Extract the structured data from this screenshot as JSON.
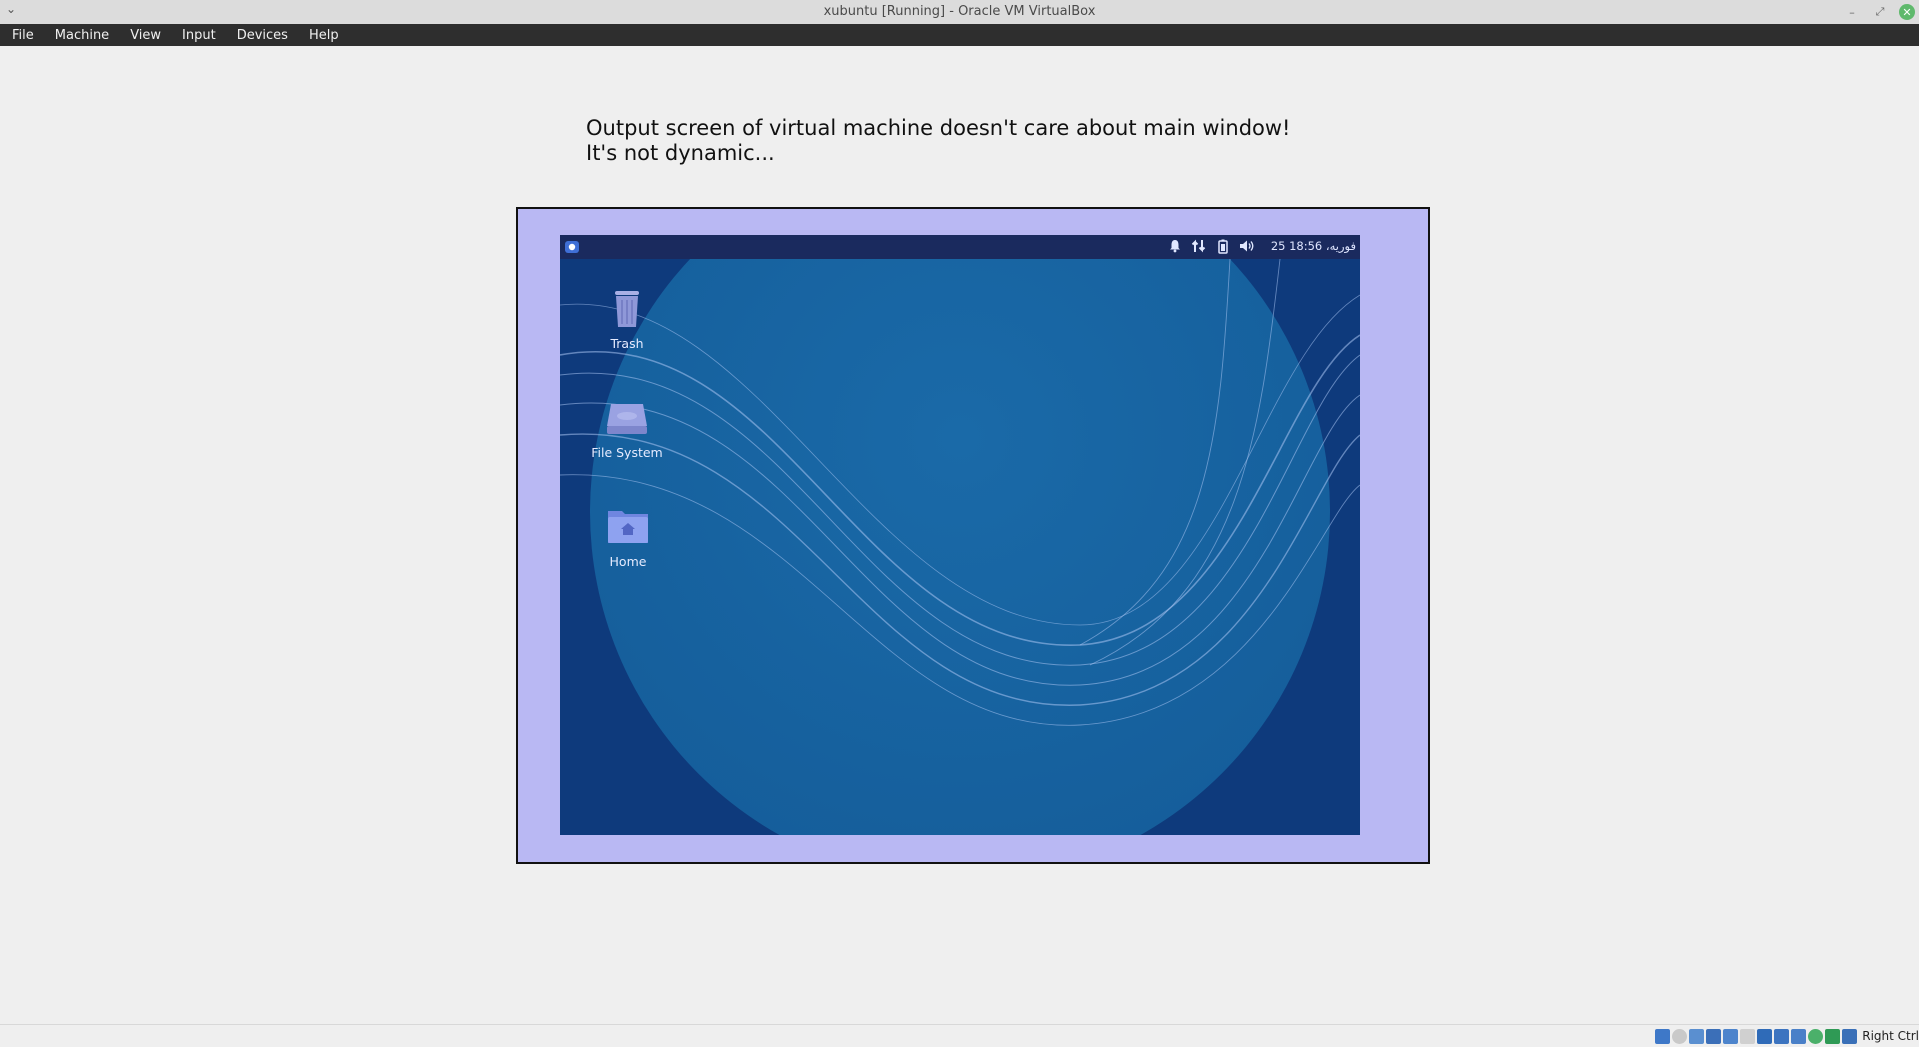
{
  "window": {
    "title": "xubuntu [Running] - Oracle VM VirtualBox"
  },
  "menubar": {
    "items": [
      "File",
      "Machine",
      "View",
      "Input",
      "Devices",
      "Help"
    ]
  },
  "note": {
    "line1": "Output screen of virtual machine doesn't care about main window!",
    "line2": "It's not dynamic..."
  },
  "guest": {
    "panel": {
      "clock": "25 فوریه، 18:56"
    },
    "desktop_icons": [
      {
        "label": "Trash",
        "icon": "trash-icon"
      },
      {
        "label": "File System",
        "icon": "drive-icon"
      },
      {
        "label": "Home",
        "icon": "home-folder-icon"
      }
    ]
  },
  "statusbar": {
    "host_key": "Right Ctrl",
    "icon_names": [
      "hard-disk-icon",
      "optical-drive-icon",
      "audio-icon",
      "network-icon",
      "usb-icon",
      "shared-folder-icon",
      "display-icon",
      "recording-icon",
      "video-capture-icon",
      "cpu-icon",
      "mouse-integration-icon",
      "keyboard-icon"
    ]
  },
  "colors": {
    "vm_frame_bg": "#b9b8f3",
    "guest_bg": "#0e3777",
    "menubar_bg": "#2e2e2e"
  }
}
